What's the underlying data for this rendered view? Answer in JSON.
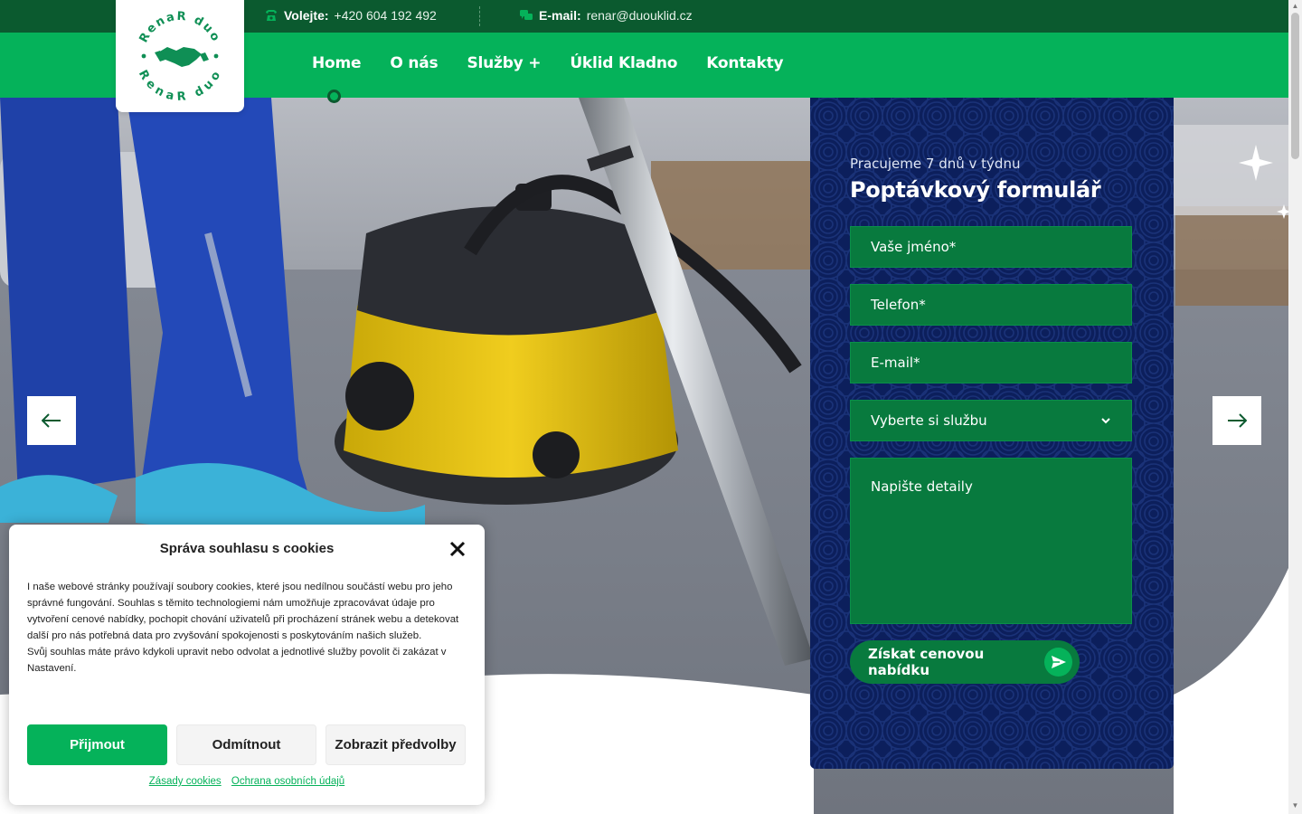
{
  "topbar": {
    "phone_label": "Volejte:",
    "phone_value": "+420 604 192 492",
    "email_label": "E-mail:",
    "email_value": "renar@duouklid.cz"
  },
  "logo": {
    "top_text": "RenaR duo",
    "bottom_text": "RenaR duo",
    "icon": "handshake-icon"
  },
  "nav": {
    "items": [
      {
        "label": "Home",
        "active": true
      },
      {
        "label": "O nás"
      },
      {
        "label": "Služby +"
      },
      {
        "label": "Úklid Kladno"
      },
      {
        "label": "Kontakty"
      }
    ]
  },
  "form": {
    "subtitle": "Pracujeme 7 dnů v týdnu",
    "title": "Poptávkový formulář",
    "name_placeholder": "Vaše jméno*",
    "phone_placeholder": "Telefon*",
    "email_placeholder": "E-mail*",
    "service_select": "Vyberte si službu",
    "details_placeholder": "Napište detaily",
    "submit_label": "Získat cenovou nabídku"
  },
  "cookie": {
    "title": "Správa souhlasu s cookies",
    "text_1": "I naše webové stránky používají soubory cookies, které jsou nedílnou součástí webu pro jeho správné fungování. Souhlas s těmito technologiemi nám umožňuje zpracovávat údaje pro vytvoření cenové nabídky, pochopit chování uživatelů při procházení stránek webu a detekovat další pro nás potřebná data pro zvyšování spokojenosti s poskytováním našich služeb.",
    "text_2": "Svůj souhlas máte právo kdykoli upravit nebo odvolat a jednotlivé služby povolit či zakázat v Nastavení.",
    "accept_label": "Přijmout",
    "deny_label": "Odmítnout",
    "prefs_label": "Zobrazit předvolby",
    "link_cookies": "Zásady cookies",
    "link_privacy": "Ochrana osobních údajů"
  },
  "colors": {
    "dark_green": "#0b5a2f",
    "brand_green": "#05b25a",
    "form_navy": "#0c1f5c",
    "field_green": "#087a3e"
  }
}
